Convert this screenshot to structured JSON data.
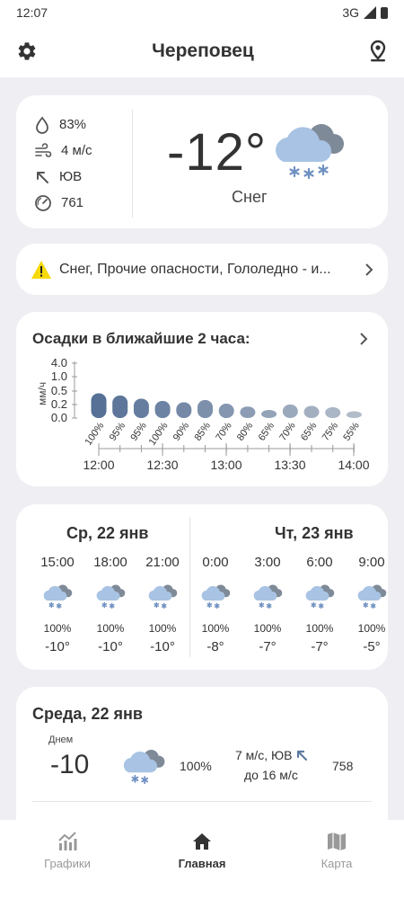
{
  "status": {
    "time": "12:07",
    "network": "3G"
  },
  "header": {
    "city": "Череповец"
  },
  "current": {
    "humidity": "83%",
    "wind": "4 м/с",
    "wind_dir": "ЮВ",
    "pressure": "761",
    "temperature": "-12°",
    "description": "Снег"
  },
  "alert": {
    "text": "Снег, Прочие опасности, Гололедно - и..."
  },
  "precip": {
    "title": "Осадки в ближайшие 2 часа:",
    "ylabel": "мм/ч",
    "yticks": [
      "4.0",
      "1.0",
      "0.5",
      "0.2",
      "0.0"
    ],
    "probabilities": [
      "100%",
      "95%",
      "95%",
      "100%",
      "90%",
      "85%",
      "70%",
      "80%",
      "65%",
      "70%",
      "65%",
      "75%",
      "55%"
    ],
    "xticks": [
      "12:00",
      "12:30",
      "13:00",
      "13:30",
      "14:00"
    ]
  },
  "chart_data": {
    "type": "bar",
    "categories": [
      "12:00",
      "12:10",
      "12:20",
      "12:30",
      "12:40",
      "12:50",
      "13:00",
      "13:10",
      "13:20",
      "13:30",
      "13:40",
      "13:50",
      "14:00"
    ],
    "values": [
      0.45,
      0.4,
      0.33,
      0.28,
      0.25,
      0.3,
      0.22,
      0.17,
      0.12,
      0.2,
      0.18,
      0.16,
      0.1
    ],
    "title": "Осадки в ближайшие 2 часа:",
    "ylabel": "мм/ч",
    "ytick_labels": [
      "0.0",
      "0.2",
      "0.5",
      "1.0",
      "4.0"
    ],
    "ylim": [
      0,
      4.0
    ],
    "grid": false
  },
  "hourly": {
    "day1": "Ср, 22 янв",
    "day2": "Чт, 23 янв",
    "items": [
      {
        "time": "15:00",
        "pct": "100%",
        "temp": "-10°"
      },
      {
        "time": "18:00",
        "pct": "100%",
        "temp": "-10°"
      },
      {
        "time": "21:00",
        "pct": "100%",
        "temp": "-10°"
      },
      {
        "time": "0:00",
        "pct": "100%",
        "temp": "-8°"
      },
      {
        "time": "3:00",
        "pct": "100%",
        "temp": "-7°"
      },
      {
        "time": "6:00",
        "pct": "100%",
        "temp": "-7°"
      },
      {
        "time": "9:00",
        "pct": "100%",
        "temp": "-5°"
      }
    ]
  },
  "daily": {
    "title": "Среда, 22 янв",
    "period": "Днем",
    "temp": "-10",
    "pct": "100%",
    "wind": "7 м/с, ЮВ",
    "gust": "до 16 м/с",
    "pressure": "758"
  },
  "nav": {
    "charts": "Графики",
    "home": "Главная",
    "map": "Карта"
  },
  "colors": {
    "accent": "#5f7b9f",
    "background": "#efeff3",
    "card": "#ffffff",
    "warning": "#f5d90a"
  }
}
